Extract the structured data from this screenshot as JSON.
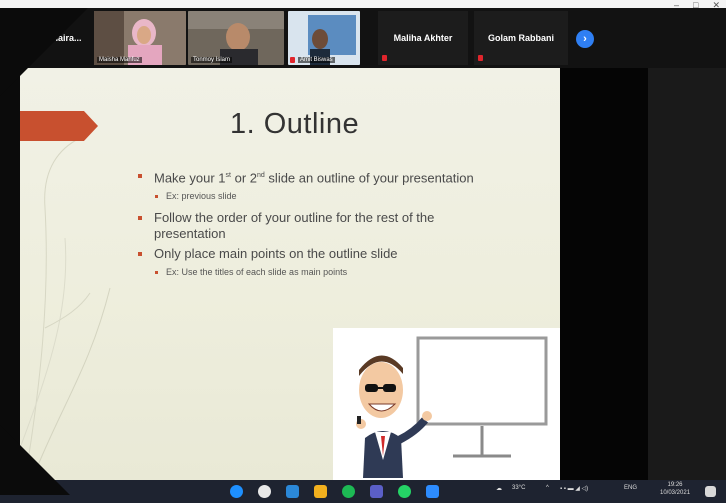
{
  "window_controls": {
    "minimize": "–",
    "maximize": "□",
    "close": "✕"
  },
  "gallery": {
    "participants": [
      {
        "name": "Jamaira...",
        "video": false
      },
      {
        "name": "Maisha Mahfuz",
        "video": true
      },
      {
        "name": "Tonmoy Islam",
        "video": true
      },
      {
        "name": "Amit Biswas",
        "video": true
      },
      {
        "name": "Maliha Akhter",
        "video": false
      },
      {
        "name": "Golam Rabbani",
        "video": false
      }
    ],
    "next_page_icon": "chevron-right-icon"
  },
  "slide": {
    "title": "1. Outline",
    "bullets": [
      {
        "level": 1,
        "text_before": "Make your 1",
        "sup1": "st",
        "text_mid": " or 2",
        "sup2": "nd",
        "text_after": " slide an outline of your presentation"
      },
      {
        "level": 2,
        "text": "Ex: previous slide"
      },
      {
        "level": 1,
        "text": "Follow the order of your outline for the rest of the presentation"
      },
      {
        "level": 1,
        "text": "Only place main points on the outline slide"
      },
      {
        "level": 2,
        "text": "Ex: Use the titles of each slide as main points"
      }
    ],
    "accent_color": "#c8502f",
    "clipart": "presenter-with-board"
  },
  "taskbar": {
    "weather": "33°C",
    "language": "ENG",
    "time": "19:26",
    "date": "10/03/2021"
  }
}
